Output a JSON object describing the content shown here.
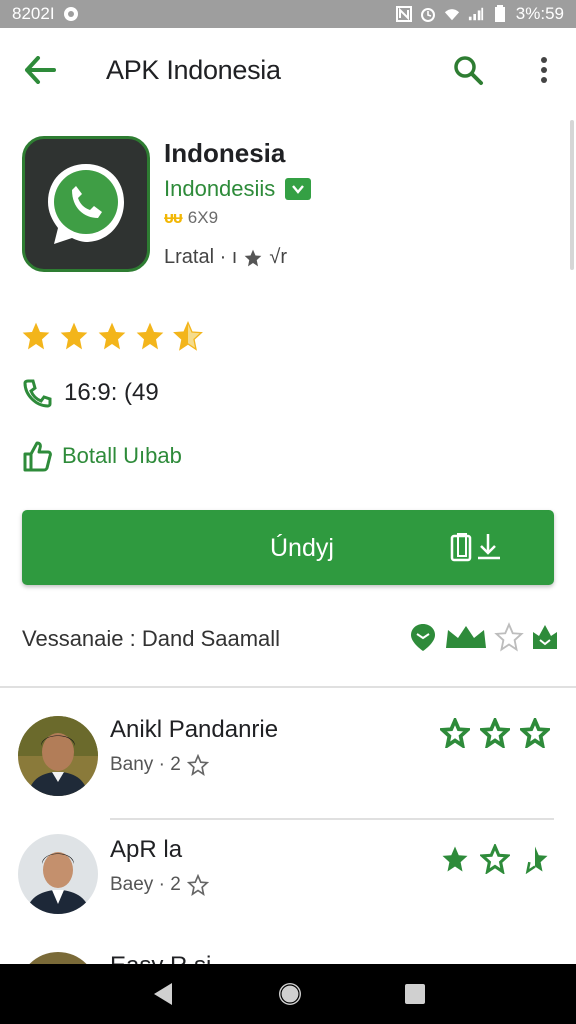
{
  "status_bar": {
    "left_text": "8202I",
    "right_text": "3%:59"
  },
  "app_bar": {
    "title": "APK Indonesia"
  },
  "app": {
    "name": "Indonesia",
    "developer": "Indondesiis",
    "meta_mark": "ᵾᵾ",
    "meta_text": "6X9",
    "info_text": "Lratal · ı",
    "info_suffix": "√r",
    "rating_stars": 4.5
  },
  "phone_row": {
    "text": "16:9: (49"
  },
  "install_row": {
    "text": "Botall Uıbab"
  },
  "primary_button": {
    "label": "Úndyj"
  },
  "version_row": {
    "text": "Vessanaie : Dand Saamall"
  },
  "reviews": [
    {
      "name": "Anikl Pandanrie",
      "sub": "Bany · 2"
    },
    {
      "name": "ApR la",
      "sub": "Baey · 2"
    },
    {
      "name": "Easy R si ",
      "sub": ""
    }
  ],
  "colors": {
    "brand_green": "#2f9a3f",
    "star_yellow": "#f3b51b",
    "status_bar": "#9e9e9e"
  }
}
